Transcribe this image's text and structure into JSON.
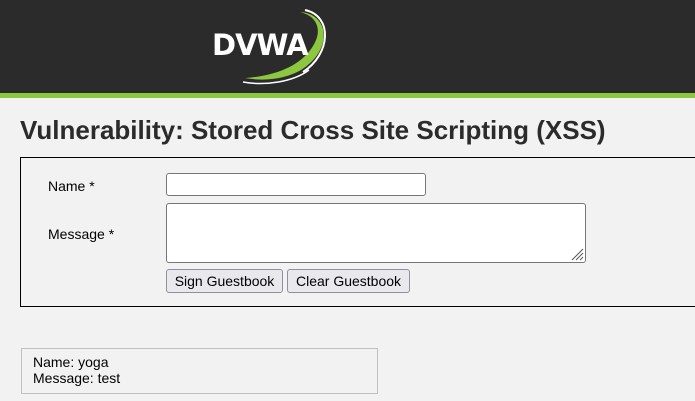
{
  "header": {
    "logo_text": "DVWA"
  },
  "colors": {
    "header_bg": "#2b2b2b",
    "accent_green": "#8dc63f",
    "page_bg": "#f2f2f2",
    "title_text": "#2b2b2b"
  },
  "main": {
    "title": "Vulnerability: Stored Cross Site Scripting (XSS)"
  },
  "form": {
    "name_label": "Name *",
    "name_value": "",
    "message_label": "Message *",
    "message_value": "",
    "sign_button_label": "Sign Guestbook",
    "clear_button_label": "Clear Guestbook"
  },
  "guestbook": {
    "entries": [
      {
        "name_line": "Name: yoga",
        "message_line": "Message: test"
      }
    ]
  }
}
